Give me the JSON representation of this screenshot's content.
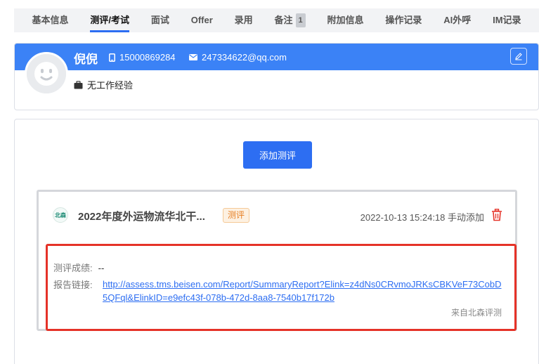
{
  "tabs": [
    {
      "label": "基本信息",
      "active": false
    },
    {
      "label": "测评/考试",
      "active": true
    },
    {
      "label": "面试",
      "active": false
    },
    {
      "label": "Offer",
      "active": false
    },
    {
      "label": "录用",
      "active": false
    },
    {
      "label": "备注",
      "active": false,
      "badge": "1"
    },
    {
      "label": "附加信息",
      "active": false
    },
    {
      "label": "操作记录",
      "active": false
    },
    {
      "label": "AI外呼",
      "active": false
    },
    {
      "label": "IM记录",
      "active": false
    }
  ],
  "profile": {
    "name": "倪倪",
    "phone": "15000869284",
    "email": "247334622@qq.com",
    "experience": "无工作经验",
    "band_color": "#3b82f6"
  },
  "main": {
    "add_button": "添加测评"
  },
  "record": {
    "logo_text": "北森",
    "title": "2022年度外运物流华北干...",
    "tag": "测评",
    "time": "2022-10-13 15:24:18 手动添加",
    "score_label": "测评成绩:",
    "score_value": "--",
    "link_label": "报告链接:",
    "link_url": "http://assess.tms.beisen.com/Report/SummaryReport?Elink=z4dNs0CRvmoJRKsCBKVeF73CobD5QFql&ElinkID=e9efc43f-078b-472d-8aa8-7540b17f172b",
    "source": "来自北森评测"
  },
  "colors": {
    "accent": "#2d6ef2",
    "highlight": "#e53228",
    "tag": "#e67e22"
  }
}
